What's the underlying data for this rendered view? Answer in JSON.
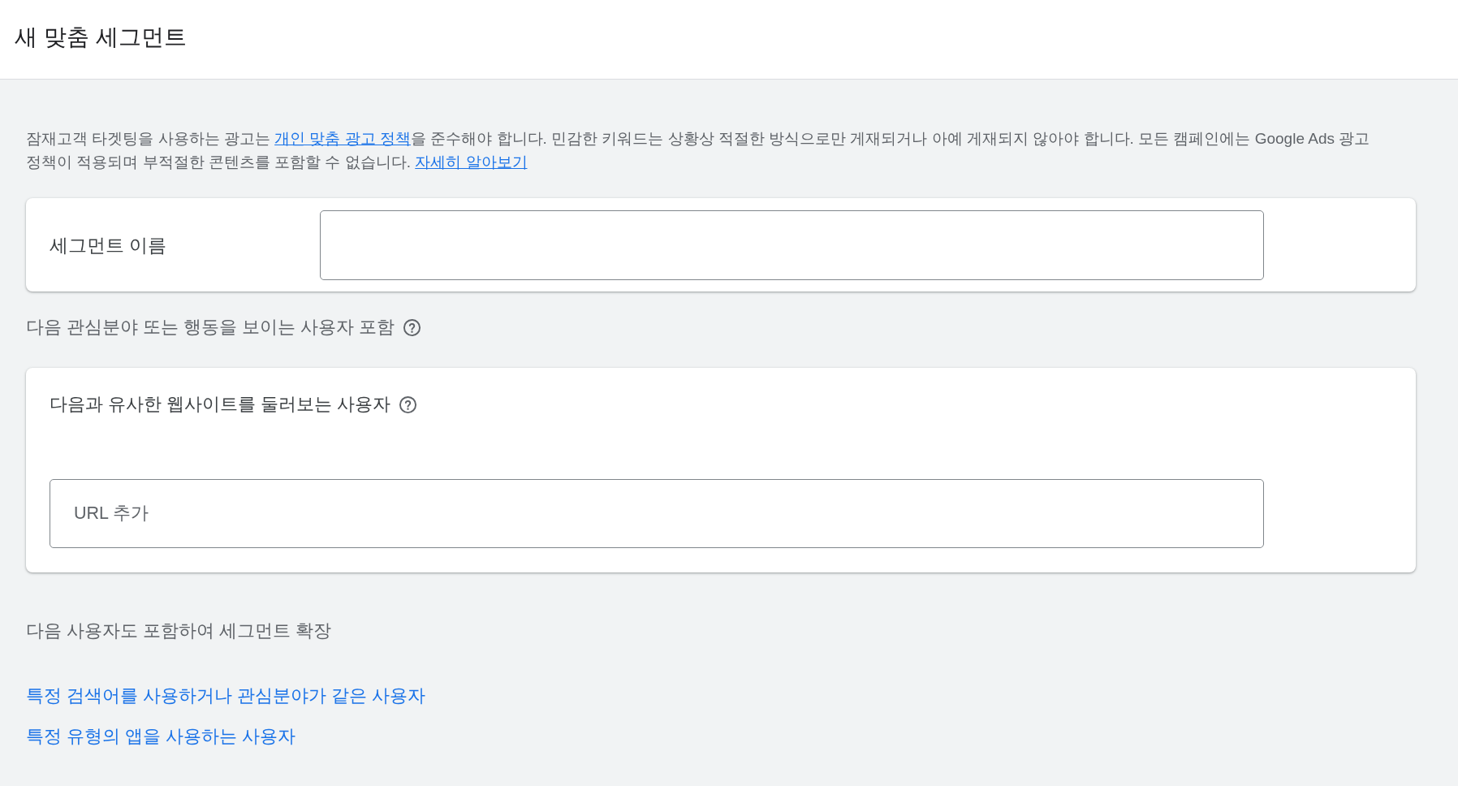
{
  "header": {
    "title": "새 맞춤 세그먼트"
  },
  "policy_notice": {
    "parts": [
      {
        "kind": "text",
        "text": "잠재고객 타겟팅을 사용하는 광고는 "
      },
      {
        "kind": "link",
        "text": "개인 맞춤 광고 정책"
      },
      {
        "kind": "text",
        "text": "을 준수해야 합니다. 민감한 키워드는 상황상 적절한 방식으로만 게재되거나 아예 게재되지 않아야 합니다. 모든 캠페인에는 Google Ads 광고 정책이 적용되며 부적절한 콘텐츠를 포함할 수 없습니다. "
      },
      {
        "kind": "link",
        "text": "자세히 알아보기"
      }
    ]
  },
  "segment_name": {
    "label": "세그먼트 이름"
  },
  "include_section": {
    "heading": "다음 관심분야 또는 행동을 보이는 사용자 포함"
  },
  "similar_websites_card": {
    "title": "다음과 유사한 웹사이트를 둘러보는 사용자",
    "url_field": {
      "placeholder": "URL 추가"
    }
  },
  "expand_section": {
    "heading": "다음 사용자도 포함하여 세그먼트 확장",
    "links": [
      "특정 검색어를 사용하거나 관심분야가 같은 사용자",
      "특정 유형의 앱을 사용하는 사용자"
    ]
  }
}
